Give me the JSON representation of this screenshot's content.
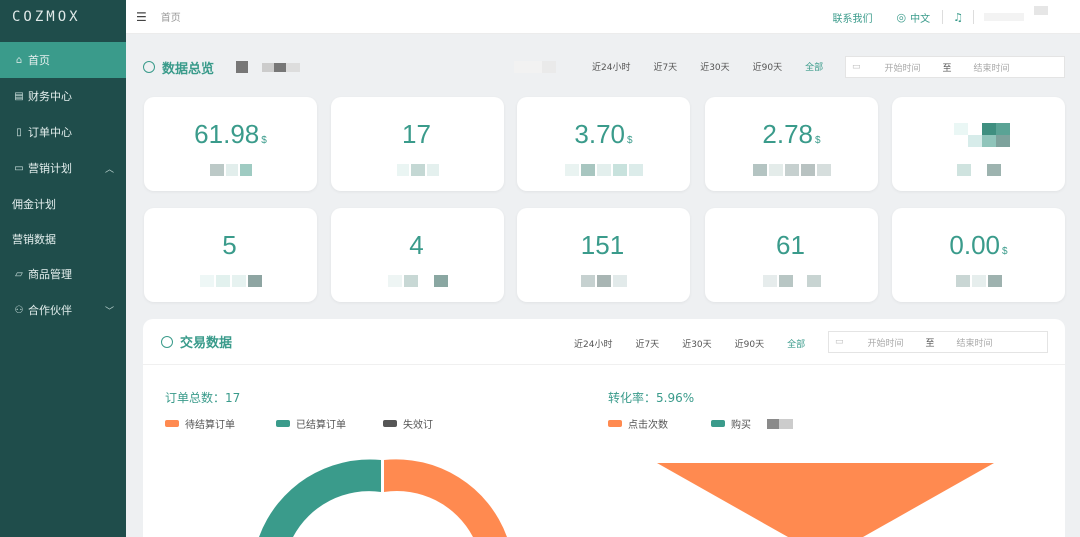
{
  "sidebar": {
    "logo": "COZMOX",
    "items": [
      {
        "label": "首页",
        "icon": "home-icon",
        "active": true
      },
      {
        "label": "财务中心",
        "icon": "finance-icon"
      },
      {
        "label": "订单中心",
        "icon": "order-icon"
      },
      {
        "label": "营销计划",
        "icon": "marketing-icon",
        "expandable": true
      },
      {
        "label": "佣金计划",
        "sub": true
      },
      {
        "label": "营销数据",
        "sub": true
      },
      {
        "label": "商品管理",
        "icon": "folder-icon"
      },
      {
        "label": "合作伙伴",
        "icon": "partner-icon",
        "expandable": true
      }
    ]
  },
  "topbar": {
    "breadcrumb": "首页",
    "contact": "联系我们",
    "language": "中文"
  },
  "overview": {
    "title": "数据总览",
    "ranges": [
      "近24小时",
      "近7天",
      "近30天",
      "近90天",
      "全部"
    ],
    "active_range": "全部",
    "start_placeholder": "开始时间",
    "to_label": "至",
    "end_placeholder": "结束时间"
  },
  "stats": [
    {
      "value": "61.98",
      "unit": "$"
    },
    {
      "value": "17",
      "unit": ""
    },
    {
      "value": "3.70",
      "unit": "$"
    },
    {
      "value": "2.78",
      "unit": "$"
    },
    {
      "value": "",
      "unit": ""
    },
    {
      "value": "5",
      "unit": ""
    },
    {
      "value": "4",
      "unit": ""
    },
    {
      "value": "151",
      "unit": ""
    },
    {
      "value": "61",
      "unit": ""
    },
    {
      "value": "0.00",
      "unit": "$"
    }
  ],
  "transactions": {
    "title": "交易数据",
    "ranges": [
      "近24小时",
      "近7天",
      "近30天",
      "近90天",
      "全部"
    ],
    "active_range": "全部",
    "start_placeholder": "开始时间",
    "to_label": "至",
    "end_placeholder": "结束时间",
    "order_total_label": "订单总数：17",
    "conversion_label": "转化率：5.96%",
    "order_legend": [
      {
        "label": "待结算订单",
        "color": "#ff8a50"
      },
      {
        "label": "已结算订单",
        "color": "#3a9b8b"
      },
      {
        "label": "失效订",
        "color": "#555555"
      }
    ],
    "funnel_legend": [
      {
        "label": "点击次数",
        "color": "#ff8a50"
      },
      {
        "label": "购买",
        "color": "#3a9b8b"
      }
    ]
  },
  "colors": {
    "accent": "#3a9b8b",
    "orange": "#ff8a50",
    "sidebar": "#1f4d4b"
  }
}
